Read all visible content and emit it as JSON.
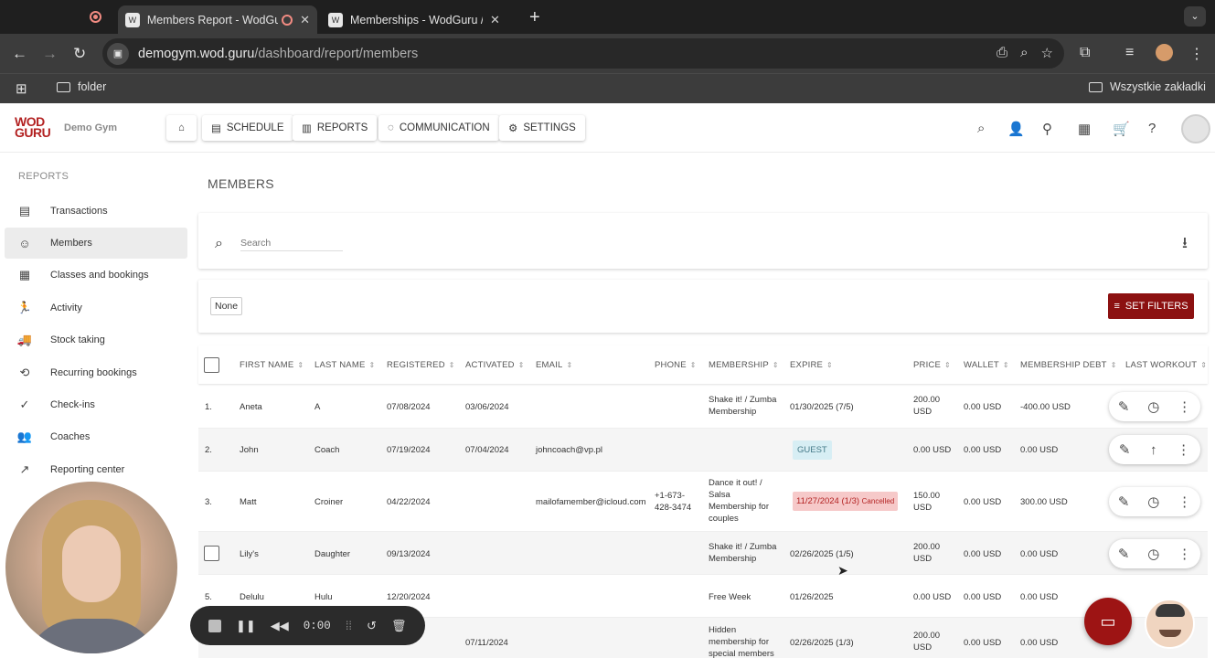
{
  "browser": {
    "tabs": [
      {
        "title": "Members Report - WodGuru",
        "active": true
      },
      {
        "title": "Memberships - WodGuru / Da",
        "active": false
      }
    ],
    "url_host": "demogym.wod.guru",
    "url_path": "/dashboard/report/members",
    "bookmarks": {
      "folder": "folder",
      "all_bookmarks": "Wszystkie zakładki"
    }
  },
  "header": {
    "logo": "WOD GURU",
    "gym_name": "Demo Gym",
    "nav": {
      "schedule": "SCHEDULE",
      "reports": "REPORTS",
      "communication": "COMMUNICATION",
      "settings": "SETTINGS"
    }
  },
  "sidebar": {
    "title": "REPORTS",
    "items": [
      {
        "label": "Transactions",
        "icon": "list-icon"
      },
      {
        "label": "Members",
        "icon": "face-icon",
        "active": true
      },
      {
        "label": "Classes and bookings",
        "icon": "calendar-icon"
      },
      {
        "label": "Activity",
        "icon": "activity-icon"
      },
      {
        "label": "Stock taking",
        "icon": "truck-icon"
      },
      {
        "label": "Recurring bookings",
        "icon": "recurring-icon"
      },
      {
        "label": "Check-ins",
        "icon": "checkin-icon"
      },
      {
        "label": "Coaches",
        "icon": "group-icon"
      },
      {
        "label": "Reporting center",
        "icon": "trend-icon"
      }
    ]
  },
  "main": {
    "title": "MEMBERS",
    "search_placeholder": "Search",
    "filter_chip": "None",
    "set_filters": "SET FILTERS"
  },
  "table": {
    "columns": [
      "FIRST NAME",
      "LAST NAME",
      "REGISTERED",
      "ACTIVATED",
      "EMAIL",
      "PHONE",
      "MEMBERSHIP",
      "EXPIRE",
      "PRICE",
      "WALLET",
      "MEMBERSHIP DEBT",
      "LAST WORKOUT"
    ],
    "rows": [
      {
        "num": "1.",
        "first": "Aneta",
        "last": "A",
        "registered": "07/08/2024",
        "activated": "03/06/2024",
        "email": "",
        "phone": "",
        "membership": "Shake it! / Zumba Membership",
        "expire": "01/30/2025 (7/5)",
        "price": "200.00 USD",
        "wallet": "0.00 USD",
        "debt": "-400.00 USD"
      },
      {
        "num": "2.",
        "first": "John",
        "last": "Coach",
        "registered": "07/19/2024",
        "activated": "07/04/2024",
        "email": "johncoach@vp.pl",
        "phone": "",
        "membership": "",
        "expire_badge": "GUEST",
        "price": "0.00 USD",
        "wallet": "0.00 USD",
        "debt": "0.00 USD"
      },
      {
        "num": "3.",
        "first": "Matt",
        "last": "Croiner",
        "registered": "04/22/2024",
        "activated": "",
        "email": "mailofamember@icloud.com",
        "phone": "+1-673-428-3474",
        "membership": "Dance it out! / Salsa Membership for couples",
        "expire": "11/27/2024 (1/3)",
        "expire_status": "Cancelled",
        "price": "150.00 USD",
        "wallet": "0.00 USD",
        "debt": "300.00 USD"
      },
      {
        "num": "",
        "first": "Lily's",
        "last": "Daughter",
        "registered": "09/13/2024",
        "activated": "",
        "email": "",
        "phone": "",
        "membership": "Shake it! / Zumba Membership",
        "expire": "02/26/2025 (1/5)",
        "price": "200.00 USD",
        "wallet": "0.00 USD",
        "debt": "0.00 USD"
      },
      {
        "num": "5.",
        "first": "Delulu",
        "last": "Hulu",
        "registered": "12/20/2024",
        "activated": "",
        "email": "",
        "phone": "",
        "membership": "Free Week",
        "expire": "01/26/2025",
        "price": "0.00 USD",
        "wallet": "0.00 USD",
        "debt": "0.00 USD"
      },
      {
        "num": "",
        "first": "",
        "last": "",
        "registered": "",
        "activated": "07/11/2024",
        "email": "",
        "phone": "",
        "membership": "Hidden membership for special members",
        "expire": "02/26/2025 (1/3)",
        "price": "200.00 USD",
        "wallet": "0.00 USD",
        "debt": "0.00 USD"
      }
    ]
  },
  "recorder": {
    "timer": "0:00"
  },
  "colors": {
    "brand": "#8c1111",
    "guest_bg": "#d7eef4",
    "cancel_bg": "#f6c9c9"
  }
}
